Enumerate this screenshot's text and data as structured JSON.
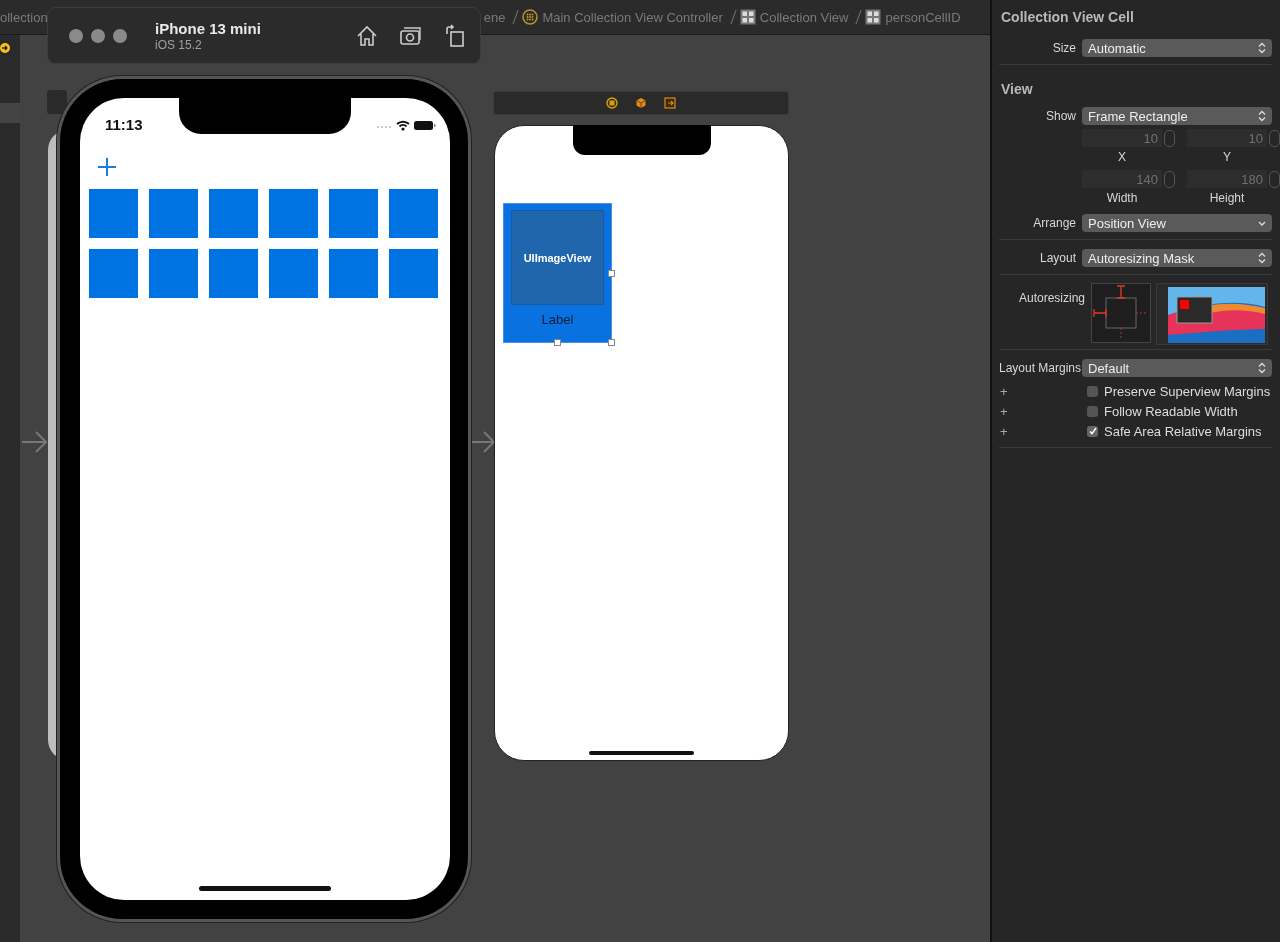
{
  "breadcrumbs": [
    {
      "label": "ollection",
      "kind": "plain"
    },
    {
      "label": "ene",
      "kind": "plain"
    },
    {
      "label": "Main Collection View Controller",
      "kind": "controller"
    },
    {
      "label": "Collection View",
      "kind": "grid"
    },
    {
      "label": "personCellID",
      "kind": "grid"
    }
  ],
  "simulator": {
    "device": "iPhone 13 mini",
    "os": "iOS 15.2"
  },
  "phone": {
    "time": "11:13"
  },
  "cell_prototype": {
    "image_view": "UIImageView",
    "label": "Label"
  },
  "inspector": {
    "title": "Collection View Cell",
    "size": {
      "label": "Size",
      "value": "Automatic",
      "kind": "stepper"
    },
    "section": "View",
    "show": {
      "label": "Show",
      "value": "Frame Rectangle",
      "kind": "stepper"
    },
    "frame_fields": [
      {
        "value": "10",
        "caption": "X",
        "disabled": true
      },
      {
        "value": "10",
        "caption": "Y",
        "disabled": true
      },
      {
        "value": "140",
        "caption": "Width",
        "disabled": true
      },
      {
        "value": "180",
        "caption": "Height",
        "disabled": true
      }
    ],
    "arrange": {
      "label": "Arrange",
      "value": "Position View",
      "kind": "pulldown"
    },
    "layout": {
      "label": "Layout",
      "value": "Autoresizing Mask",
      "kind": "stepper"
    },
    "autoresizing_label": "Autoresizing",
    "layout_margins": {
      "label": "Layout Margins",
      "value": "Default",
      "kind": "stepper"
    },
    "options": [
      {
        "plus": "+",
        "label": "Preserve Superview Margins",
        "checked": false
      },
      {
        "plus": "+",
        "label": "Follow Readable Width",
        "checked": false
      },
      {
        "plus": "+",
        "label": "Safe Area Relative Margins",
        "checked": true
      }
    ]
  }
}
